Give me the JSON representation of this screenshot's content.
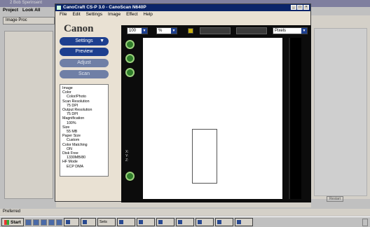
{
  "background_app": {
    "title": "2 Bob Sperinsent",
    "window_buttons": "",
    "menu": [
      "Project",
      "Look All"
    ],
    "toolbar_label": "Image Proc",
    "right_button": "Restart",
    "status": "Preferred"
  },
  "dialog": {
    "title": "CanoCraft CS-P 3.0 - CanoScan N640P",
    "menu": [
      "File",
      "Edit",
      "Settings",
      "Image",
      "Effect",
      "Help"
    ],
    "logo": "Canon",
    "buttons": {
      "settings": "Settings",
      "preview": "Preview",
      "adjust": "Adjust",
      "scan": "Scan"
    },
    "info": [
      {
        "label": "Image",
        "value": ""
      },
      {
        "label": "Color",
        "value": "Color/Photo"
      },
      {
        "label": "Scan Resolution",
        "value": "75 DPI"
      },
      {
        "label": "Output Resolution",
        "value": "75 DPI"
      },
      {
        "label": "Magnification",
        "value": "100%"
      },
      {
        "label": "Size",
        "value": "55 MB"
      },
      {
        "label": "Paper Size",
        "value": "Custom"
      },
      {
        "label": "Color Matching",
        "value": "ON"
      },
      {
        "label": "Disk Free",
        "value": "1330MB/80"
      },
      {
        "label": "HF Mode",
        "value": "ECP DMA"
      }
    ]
  },
  "preview_toolbar": {
    "zoom_value": "100",
    "unit_value": "%",
    "field_1": "",
    "field_2": "",
    "units": "Pixels"
  },
  "coords": {
    "x": "X:",
    "y": "Y:",
    "z": "Z:"
  },
  "taskbar": {
    "start": "Start",
    "clock": "",
    "tasks": [
      "",
      "",
      "Sets",
      "",
      "",
      "",
      "",
      "",
      "",
      "",
      ""
    ]
  }
}
